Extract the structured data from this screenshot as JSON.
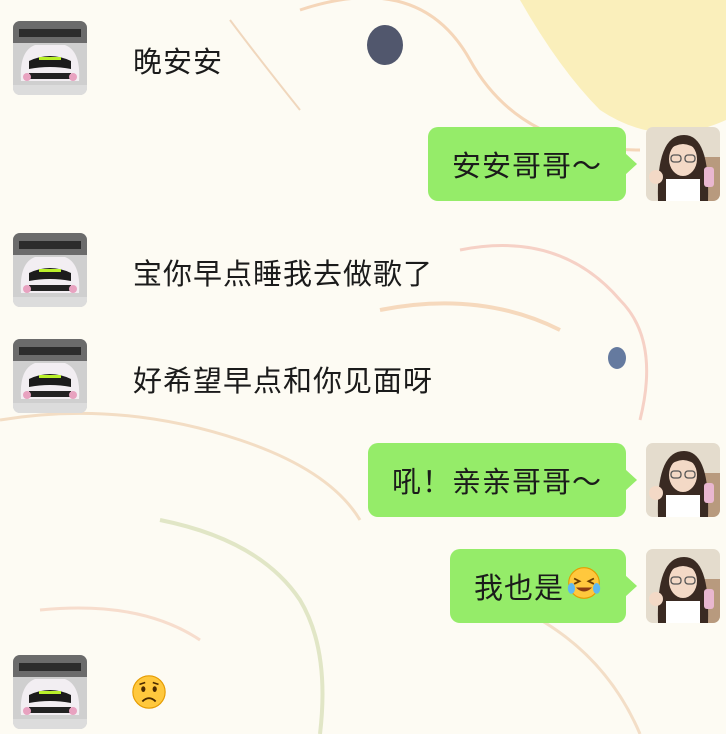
{
  "messages": [
    {
      "side": "left",
      "text": "晚安安"
    },
    {
      "side": "right",
      "text": "安安哥哥～"
    },
    {
      "side": "left",
      "text": "宝你早点睡我去做歌了"
    },
    {
      "side": "left",
      "text": "好希望早点和你见面呀"
    },
    {
      "side": "right",
      "text": "吼！亲亲哥哥～"
    },
    {
      "side": "right",
      "text": "我也是",
      "emoji": "tears-of-joy-emoji"
    },
    {
      "side": "left",
      "emoji": "frowning-face-emoji"
    }
  ],
  "colors": {
    "bubble_green": "#95ec69",
    "text": "#1b1b1b",
    "background": "#fdfbf3"
  },
  "icons": {
    "left_avatar": "race-car-avatar-icon",
    "right_avatar": "girl-avatar-icon"
  }
}
